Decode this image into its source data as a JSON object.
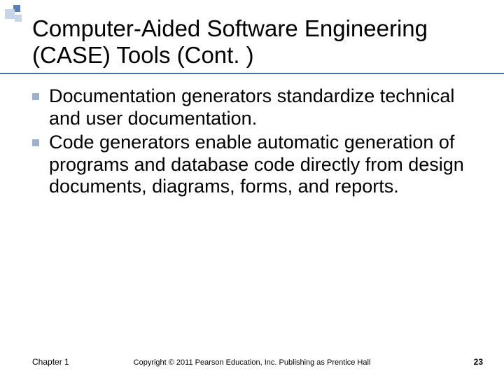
{
  "slide": {
    "title": "Computer-Aided Software Engineering (CASE) Tools (Cont. )",
    "bullets": [
      "Documentation generators standardize technical and user documentation.",
      "Code generators enable automatic generation of programs and database code directly from design documents, diagrams, forms, and reports."
    ],
    "footer": {
      "chapter": "Chapter 1",
      "copyright": "Copyright © 2011 Pearson Education, Inc. Publishing as Prentice Hall",
      "page": "23"
    }
  }
}
